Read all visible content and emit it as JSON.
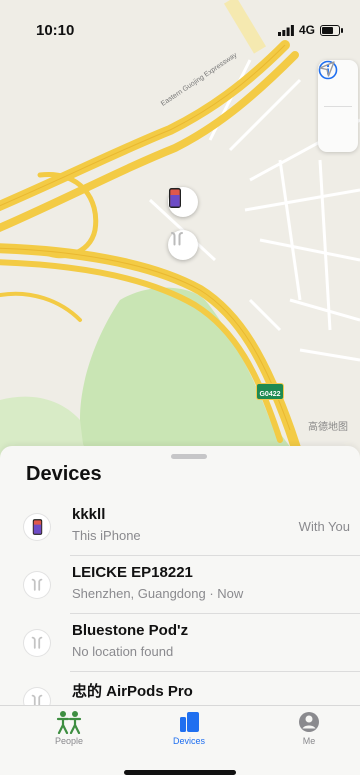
{
  "status_bar": {
    "time": "10:10",
    "network": "4G"
  },
  "map": {
    "road_label": "Eastern Guojing Expressway",
    "road_badge": "G0422",
    "watermark": "高德地图",
    "colors": {
      "highway": "#f3cb45",
      "park": "#c9e5b4",
      "land": "#efede6"
    }
  },
  "map_controls": {
    "info_icon": "info-icon",
    "location_icon": "location-arrow-icon"
  },
  "sheet": {
    "title": "Devices",
    "devices": [
      {
        "name": "kkkll",
        "subtitle": "This iPhone",
        "status": "With You",
        "icon": "iphone-icon"
      },
      {
        "name": "LEICKE EP18221",
        "subtitle": "Shenzhen, Guangdong · Now",
        "status": "",
        "icon": "airpods-icon"
      },
      {
        "name": "Bluestone Pod'z",
        "subtitle": "No location found",
        "status": "",
        "icon": "airpods-icon"
      },
      {
        "name": "忠的 AirPods Pro",
        "subtitle": "",
        "status": "",
        "icon": "airpods-icon"
      }
    ]
  },
  "tab_bar": {
    "tabs": [
      {
        "label": "People",
        "icon": "people-icon",
        "active": false
      },
      {
        "label": "Devices",
        "icon": "devices-icon",
        "active": true
      },
      {
        "label": "Me",
        "icon": "person-icon",
        "active": false
      }
    ],
    "active_color": "#1f6ff0"
  }
}
